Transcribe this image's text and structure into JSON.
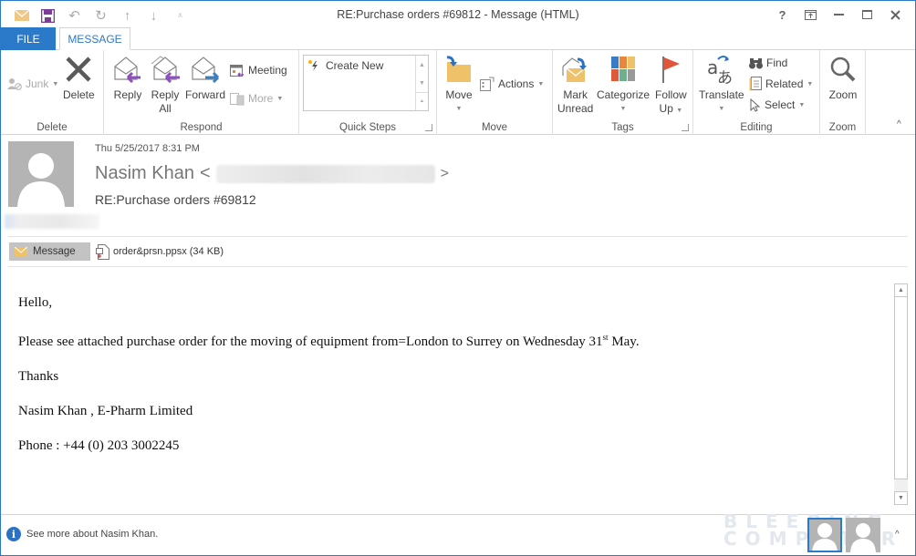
{
  "window": {
    "title": "RE:Purchase orders #69812 - Message (HTML)",
    "controls": [
      "help",
      "ribbon-display-options",
      "minimize",
      "maximize",
      "close"
    ]
  },
  "qat": {
    "icons": [
      "mail-icon",
      "save-icon",
      "undo-icon",
      "redo-icon",
      "previous-item-icon",
      "next-item-icon",
      "customize-icon"
    ]
  },
  "tabs": [
    {
      "label": "FILE",
      "active": false
    },
    {
      "label": "MESSAGE",
      "active": true
    }
  ],
  "ribbon": {
    "groups": {
      "delete": {
        "label": "Delete",
        "junk": "Junk",
        "delete": "Delete"
      },
      "respond": {
        "label": "Respond",
        "reply": "Reply",
        "reply_all_1": "Reply",
        "reply_all_2": "All",
        "forward": "Forward",
        "meeting": "Meeting",
        "more": "More"
      },
      "quick_steps": {
        "label": "Quick Steps",
        "items": [
          "Create New"
        ]
      },
      "move": {
        "label": "Move",
        "move": "Move",
        "actions": "Actions"
      },
      "tags": {
        "label": "Tags",
        "mark_unread_1": "Mark",
        "mark_unread_2": "Unread",
        "categorize": "Categorize",
        "follow_up_1": "Follow",
        "follow_up_2": "Up"
      },
      "editing": {
        "label": "Editing",
        "translate": "Translate",
        "find": "Find",
        "related": "Related",
        "select": "Select"
      },
      "zoom": {
        "label": "Zoom",
        "zoom": "Zoom"
      }
    }
  },
  "message": {
    "date": "Thu 5/25/2017 8:31 PM",
    "sender_name": "Nasim Khan",
    "email_open": "<",
    "email_close": ">",
    "subject": "RE:Purchase orders #69812",
    "attachments": {
      "message_tab": "Message",
      "file": "order&prsn.ppsx (34 KB)"
    },
    "body": {
      "greeting": "Hello,",
      "line1_a": "Please see attached purchase order for the moving of equipment from=London to Surrey on Wednesday 31",
      "line1_sup": "st",
      "line1_b": " May.",
      "thanks": "Thanks",
      "signature": "Nasim Khan , E-Pharm Limited",
      "phone": "Phone : +44 (0) 203 3002245"
    }
  },
  "footer": {
    "info": "See more about Nasim Khan.",
    "watermark_1": "BLEEPING",
    "watermark_2": "COMPUTER"
  },
  "colors": {
    "accent": "#2b79c9",
    "reply_arrow": "#8e4fbf",
    "forward_arrow": "#3d7fc1",
    "folder": "#efc26a",
    "flag": "#e0553b"
  }
}
